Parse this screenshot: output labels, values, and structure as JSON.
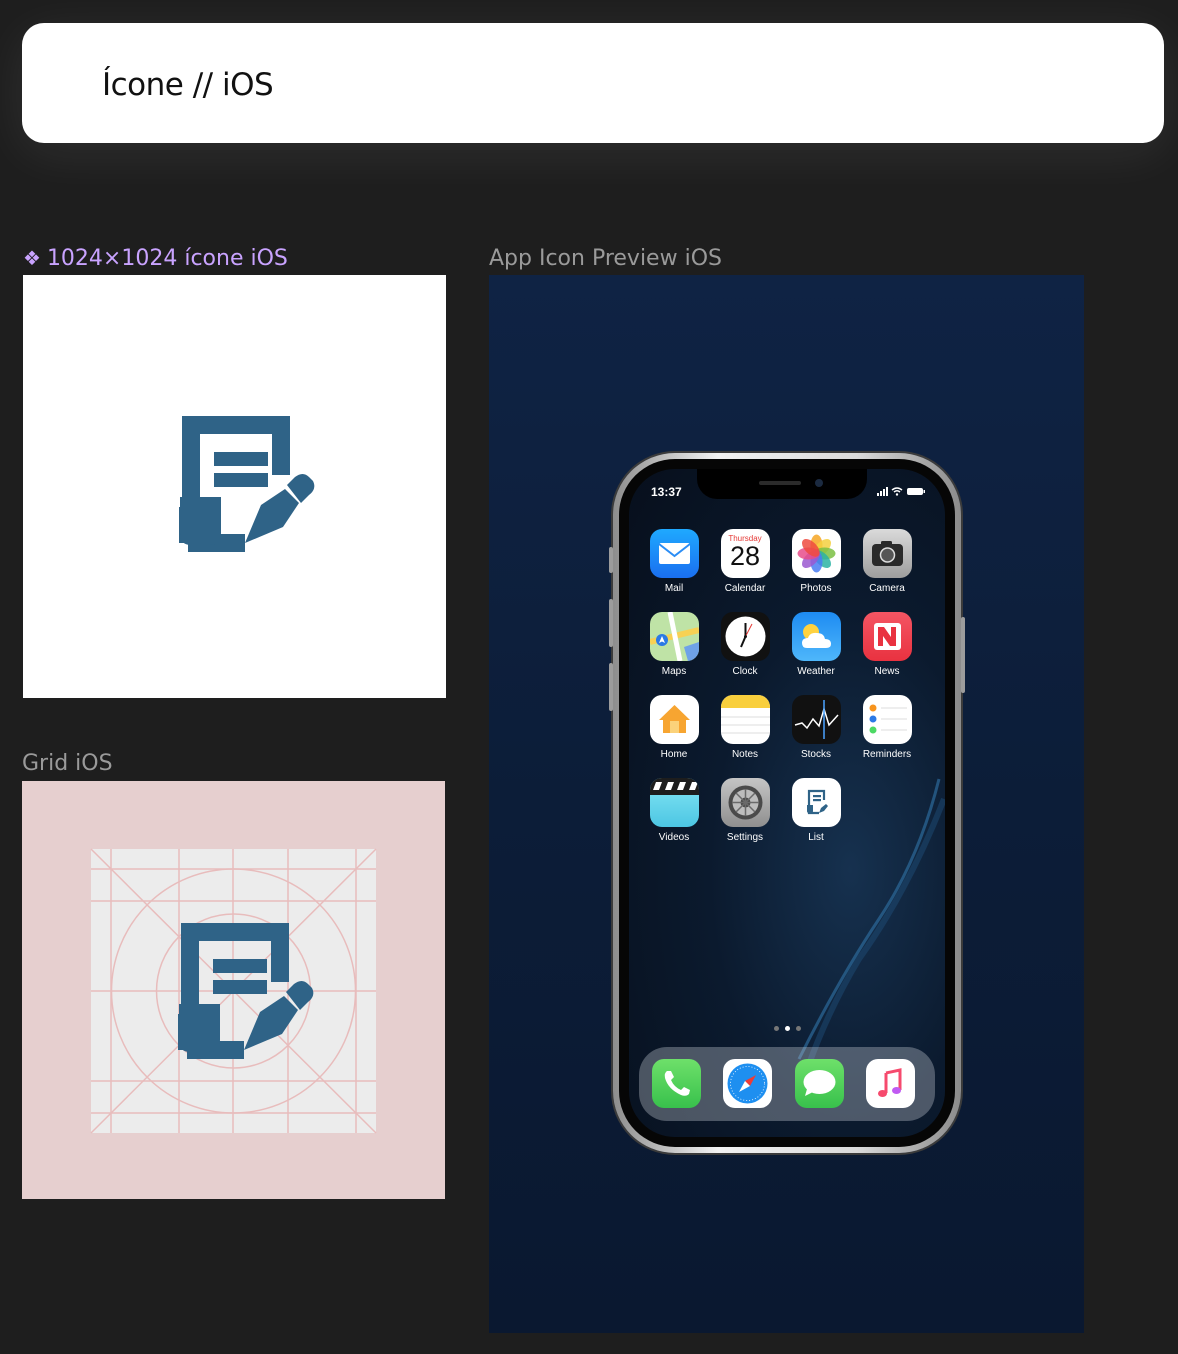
{
  "header": {
    "title": "Ícone // iOS"
  },
  "frames": {
    "icon_label": "1024×1024 ícone iOS",
    "grid_label": "Grid iOS",
    "preview_label": "App Icon Preview iOS"
  },
  "phone": {
    "time": "13:37",
    "apps": [
      {
        "label": "Mail",
        "icon": "mail-icon"
      },
      {
        "label": "Calendar",
        "icon": "calendar-icon",
        "day": "Thursday",
        "date": "28"
      },
      {
        "label": "Photos",
        "icon": "photos-icon"
      },
      {
        "label": "Camera",
        "icon": "camera-icon"
      },
      {
        "label": "Maps",
        "icon": "maps-icon"
      },
      {
        "label": "Clock",
        "icon": "clock-icon"
      },
      {
        "label": "Weather",
        "icon": "weather-icon"
      },
      {
        "label": "News",
        "icon": "news-icon"
      },
      {
        "label": "Home",
        "icon": "home-icon"
      },
      {
        "label": "Notes",
        "icon": "notes-icon"
      },
      {
        "label": "Stocks",
        "icon": "stocks-icon"
      },
      {
        "label": "Reminders",
        "icon": "reminders-icon"
      },
      {
        "label": "Videos",
        "icon": "videos-icon"
      },
      {
        "label": "Settings",
        "icon": "settings-icon"
      },
      {
        "label": "List",
        "icon": "list-app-icon"
      }
    ],
    "dock": [
      "phone-icon",
      "safari-icon",
      "messages-icon",
      "music-icon"
    ]
  },
  "colors": {
    "icon_blue": "#2f6387",
    "grid_pink": "#e6cfcf",
    "grid_line": "#e8bcbc"
  }
}
